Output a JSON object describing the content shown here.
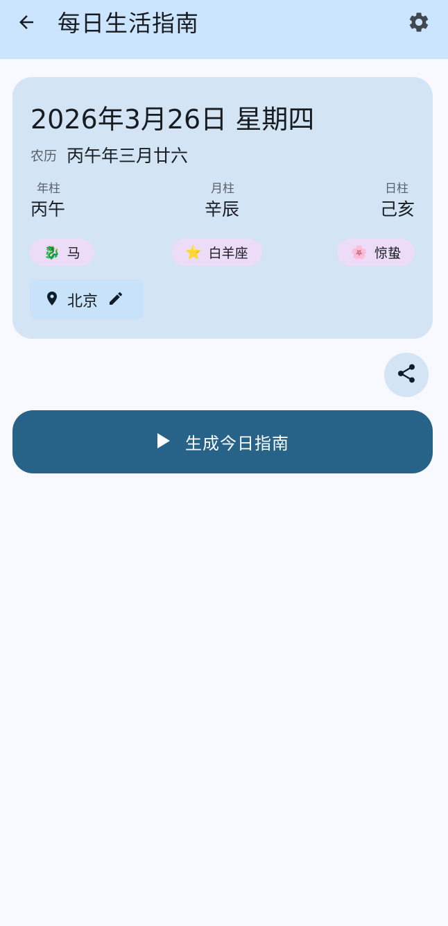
{
  "app_bar": {
    "title": "每日生活指南",
    "back_icon": "arrow-back-icon",
    "settings_icon": "gear-icon"
  },
  "date_card": {
    "date_line": "2026年3月26日 星期四",
    "lunar_label": "农历",
    "lunar_value": "丙午年三月廿六",
    "pillars": [
      {
        "label": "年柱",
        "value": "丙午"
      },
      {
        "label": "月柱",
        "value": "辛辰"
      },
      {
        "label": "日柱",
        "value": "己亥"
      }
    ],
    "chips": [
      {
        "emoji": "🐉",
        "label": "马"
      },
      {
        "emoji": "⭐",
        "label": "白羊座"
      },
      {
        "emoji": "🌸",
        "label": "惊蛰"
      }
    ],
    "location": {
      "city": "北京",
      "pin_icon": "location-pin-icon",
      "edit_icon": "pencil-edit-icon"
    }
  },
  "share_icon": "share-icon",
  "generate_button": {
    "label": "生成今日指南",
    "icon": "play-icon"
  },
  "colors": {
    "app_bar_bg": "#cce5ff",
    "page_bg": "#f7f9fe",
    "card_bg": "#d3e4f5",
    "chip_bg": "#ecdcf8",
    "location_bg": "#c8e2fa",
    "primary_button": "#276389"
  }
}
